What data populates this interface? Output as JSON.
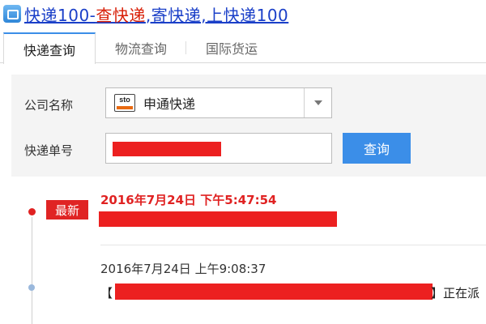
{
  "header": {
    "link_part1": "快递100-",
    "link_part2": "查快递",
    "link_part3": ",寄快递,上快递100",
    "icon": "app-logo-icon"
  },
  "tabs": [
    {
      "label": "快递查询",
      "active": true
    },
    {
      "label": "物流查询",
      "active": false
    },
    {
      "label": "国际货运",
      "active": false
    }
  ],
  "form": {
    "company_label": "公司名称",
    "company_value": "申通快递",
    "company_logo_text": "sto",
    "tracking_label": "快递单号",
    "tracking_value": "",
    "query_button": "查询"
  },
  "timeline": {
    "latest_badge": "最新",
    "entries": [
      {
        "time": "2016年7月24日 下午5:47:54",
        "latest": true
      },
      {
        "time": "2016年7月24日 上午9:08:37",
        "latest": false,
        "open_bracket": "【",
        "tail": "】正在派"
      }
    ]
  },
  "colors": {
    "accent_blue": "#3b8ee8",
    "latest_red": "#e02222",
    "link_blue": "#1a3fc8",
    "redaction": "#ec2020"
  }
}
